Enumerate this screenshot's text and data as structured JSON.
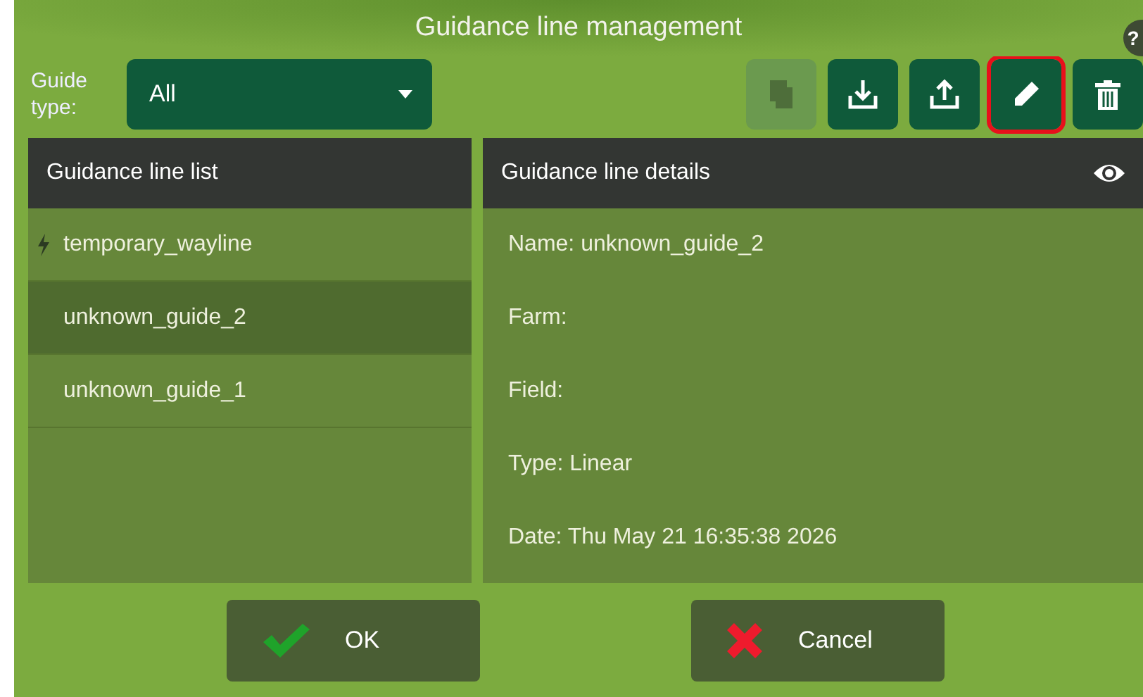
{
  "window": {
    "title": "Guidance line management",
    "help": "?"
  },
  "filter": {
    "label": "Guide type:",
    "value": "All"
  },
  "toolbar": [
    {
      "kind": "copy",
      "disabled": true,
      "highlighted": false
    },
    {
      "kind": "import",
      "disabled": false,
      "highlighted": false
    },
    {
      "kind": "export",
      "disabled": false,
      "highlighted": false
    },
    {
      "kind": "edit",
      "disabled": false,
      "highlighted": true
    },
    {
      "kind": "delete",
      "disabled": false,
      "highlighted": false
    }
  ],
  "list": {
    "title": "Guidance line list",
    "items": [
      {
        "label": "temporary_wayline",
        "kind": "temporary",
        "selected": false
      },
      {
        "label": "unknown_guide_2",
        "kind": "saved",
        "selected": true
      },
      {
        "label": "unknown_guide_1",
        "kind": "saved",
        "selected": false
      }
    ]
  },
  "details": {
    "title": "Guidance line details",
    "fields": [
      "Name: unknown_guide_2",
      "Farm:",
      "Field:",
      "Type: Linear",
      "Date: Thu May 21 16:35:38 2026"
    ]
  },
  "buttons": [
    {
      "kind": "ok",
      "label": "OK"
    },
    {
      "kind": "cancel",
      "label": "Cancel"
    }
  ]
}
